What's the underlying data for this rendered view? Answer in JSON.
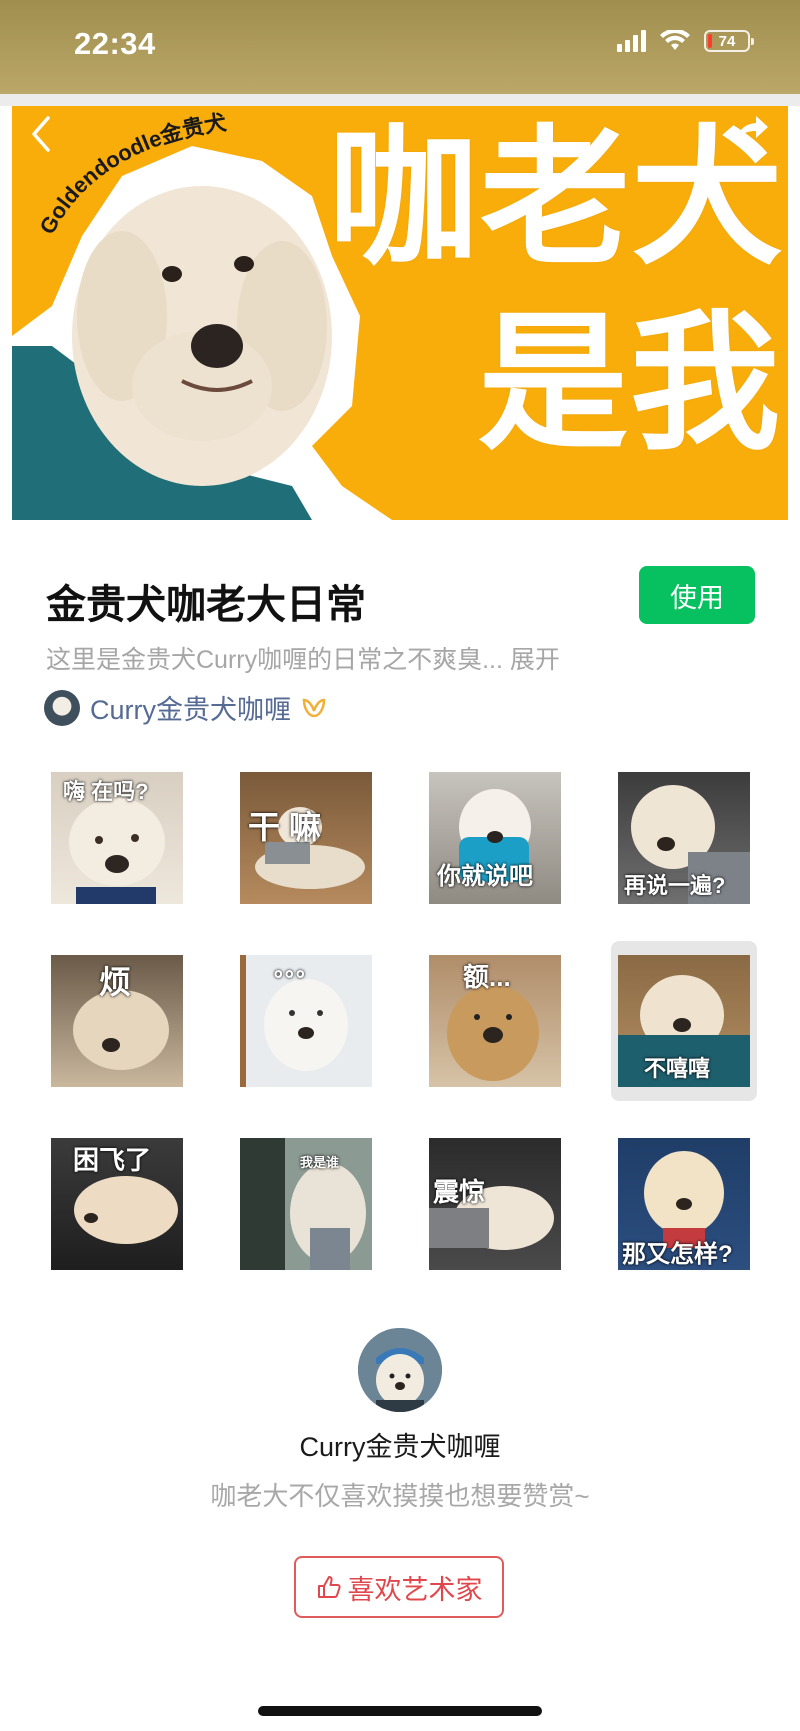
{
  "status_bar": {
    "time": "22:34",
    "battery": "74"
  },
  "banner": {
    "curved_label": "Goldendoodle金贵犬",
    "title_line1": "咖老犬",
    "title_line2": "是我",
    "colors": {
      "background": "#f8ad0b",
      "text": "#ffffff"
    }
  },
  "pack": {
    "title": "金贵犬咖老大日常",
    "use_button": "使用",
    "description": "这里是金贵犬Curry咖喱的日常之不爽臭... 展开",
    "artist_name": "Curry金贵犬咖喱"
  },
  "stickers": [
    {
      "caption": "嗨 在吗?"
    },
    {
      "caption": "干 嘛"
    },
    {
      "caption": "你就说吧"
    },
    {
      "caption": "再说一遍?"
    },
    {
      "caption": "烦"
    },
    {
      "caption": "。。。"
    },
    {
      "caption": "额..."
    },
    {
      "caption": "不嘻嘻"
    },
    {
      "caption": "困飞了"
    },
    {
      "caption": "我是谁"
    },
    {
      "caption": "震惊"
    },
    {
      "caption": "那又怎样?"
    }
  ],
  "artist_section": {
    "name": "Curry金贵犬咖喱",
    "reward_text": "咖老大不仅喜欢摸摸也想要赞赏~",
    "like_button": "喜欢艺术家"
  },
  "colors": {
    "accent_green": "#07c160",
    "link_blue": "#566b94",
    "like_red": "#e0484d"
  }
}
